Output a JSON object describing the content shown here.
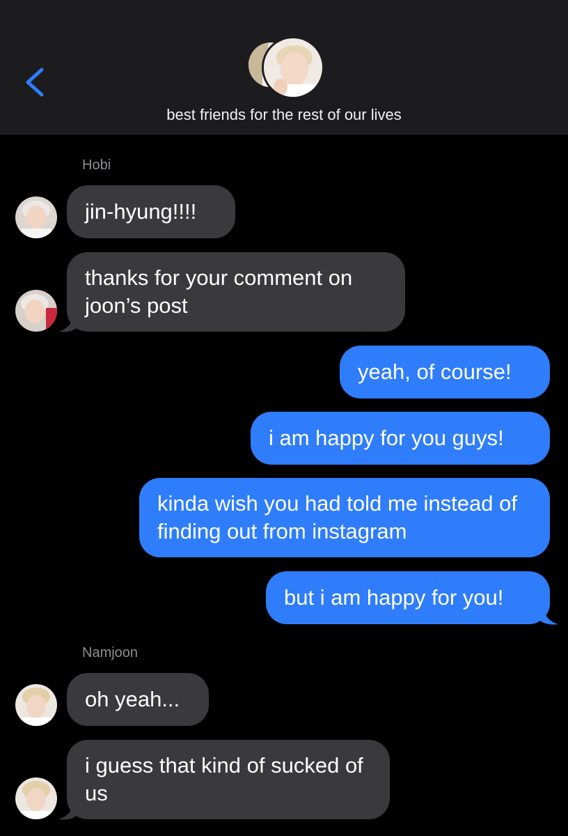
{
  "header": {
    "group_name": "best friends for the rest of our lives",
    "back_icon": "chevron-left-icon",
    "accent_color": "#2f7dfb"
  },
  "messages": [
    {
      "sender": "Hobi",
      "direction": "incoming",
      "text": "jin-hyung!!!!"
    },
    {
      "direction": "incoming",
      "text": "thanks for your comment on joon’s post"
    },
    {
      "direction": "outgoing",
      "text": "yeah, of course!"
    },
    {
      "direction": "outgoing",
      "text": "i am happy for you guys!"
    },
    {
      "direction": "outgoing",
      "text": "kinda wish you had told me instead of finding out from instagram"
    },
    {
      "direction": "outgoing",
      "text": "but i am happy for you!"
    },
    {
      "sender": "Namjoon",
      "direction": "incoming",
      "text": "oh yeah..."
    },
    {
      "direction": "incoming",
      "text": "i guess that kind of sucked of us"
    }
  ],
  "colors": {
    "incoming_bubble": "#3a3a3c",
    "outgoing_bubble": "#2f7dfb",
    "background": "#000000",
    "header_bg": "#1c1c1e"
  }
}
